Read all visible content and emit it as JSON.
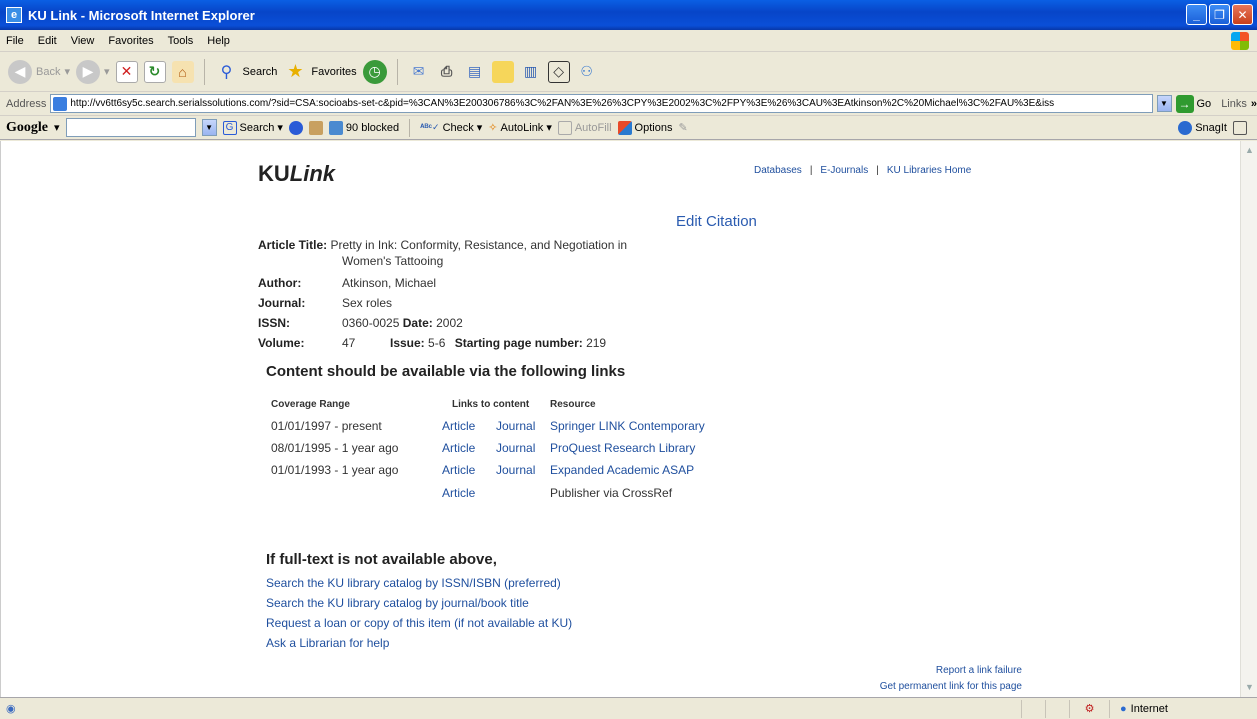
{
  "window": {
    "title": "KU Link - Microsoft Internet Explorer",
    "buttons": [
      "_",
      "❐",
      "✕"
    ]
  },
  "menu": [
    "File",
    "Edit",
    "View",
    "Favorites",
    "Tools",
    "Help"
  ],
  "toolbar": {
    "back": "Back",
    "search": "Search",
    "favorites": "Favorites"
  },
  "address": {
    "label": "Address",
    "url": "http://vv6tt6sy5c.search.serialssolutions.com/?sid=CSA:socioabs-set-c&pid=%3CAN%3E200306786%3C%2FAN%3E%26%3CPY%3E2002%3C%2FPY%3E%26%3CAU%3EAtkinson%2C%20Michael%3C%2FAU%3E&iss",
    "go": "Go",
    "links": "Links"
  },
  "google": {
    "logo": "Google",
    "search": "Search",
    "blocked": "90 blocked",
    "check": "Check",
    "autolink": "AutoLink",
    "autofill": "AutoFill",
    "options": "Options",
    "snagit": "SnagIt"
  },
  "page": {
    "logo_a": "KU",
    "logo_b": "Link",
    "nav": [
      "Databases",
      "E-Journals",
      "KU Libraries Home"
    ],
    "edit_citation": "Edit Citation",
    "citation": {
      "title_label": "Article Title:",
      "title_line1": "Pretty in Ink: Conformity, Resistance, and Negotiation in",
      "title_line2": "Women's Tattooing",
      "author_label": "Author:",
      "author": "Atkinson, Michael",
      "journal_label": "Journal:",
      "journal": "Sex roles",
      "issn_label": "ISSN:",
      "issn": "0360-0025",
      "date_label": "Date:",
      "date": "2002",
      "volume_label": "Volume:",
      "volume": "47",
      "issue_label": "Issue:",
      "issue": "5-6",
      "spage_label": "Starting page number:",
      "spage": "219"
    },
    "content_heading": "Content should be available via the following links",
    "table": {
      "headers": [
        "Coverage Range",
        "Links to content",
        "Resource"
      ],
      "rows": [
        {
          "range": "01/01/1997 - present",
          "article": "Article",
          "journal": "Journal",
          "resource": "Springer LINK Contemporary"
        },
        {
          "range": "08/01/1995 - 1 year ago",
          "article": "Article",
          "journal": "Journal",
          "resource": "ProQuest Research Library"
        },
        {
          "range": "01/01/1993 - 1 year ago",
          "article": "Article",
          "journal": "Journal",
          "resource": "Expanded Academic ASAP"
        },
        {
          "range": "",
          "article": "Article",
          "journal": "",
          "resource": "Publisher via CrossRef"
        }
      ]
    },
    "fallback_heading": "If full-text is not available above,",
    "fallback_links": [
      "Search the KU library catalog by ISSN/ISBN (preferred)",
      "Search the KU library catalog by journal/book title",
      "Request a loan or copy of this item (if not available at KU)",
      "Ask a Librarian for help"
    ],
    "report": "Report a link failure",
    "permalink": "Get permanent link for this page"
  },
  "status": {
    "zone": "Internet"
  },
  "colors": {
    "link": "#1f4f9e",
    "titlebar": "#0a5fe4"
  }
}
